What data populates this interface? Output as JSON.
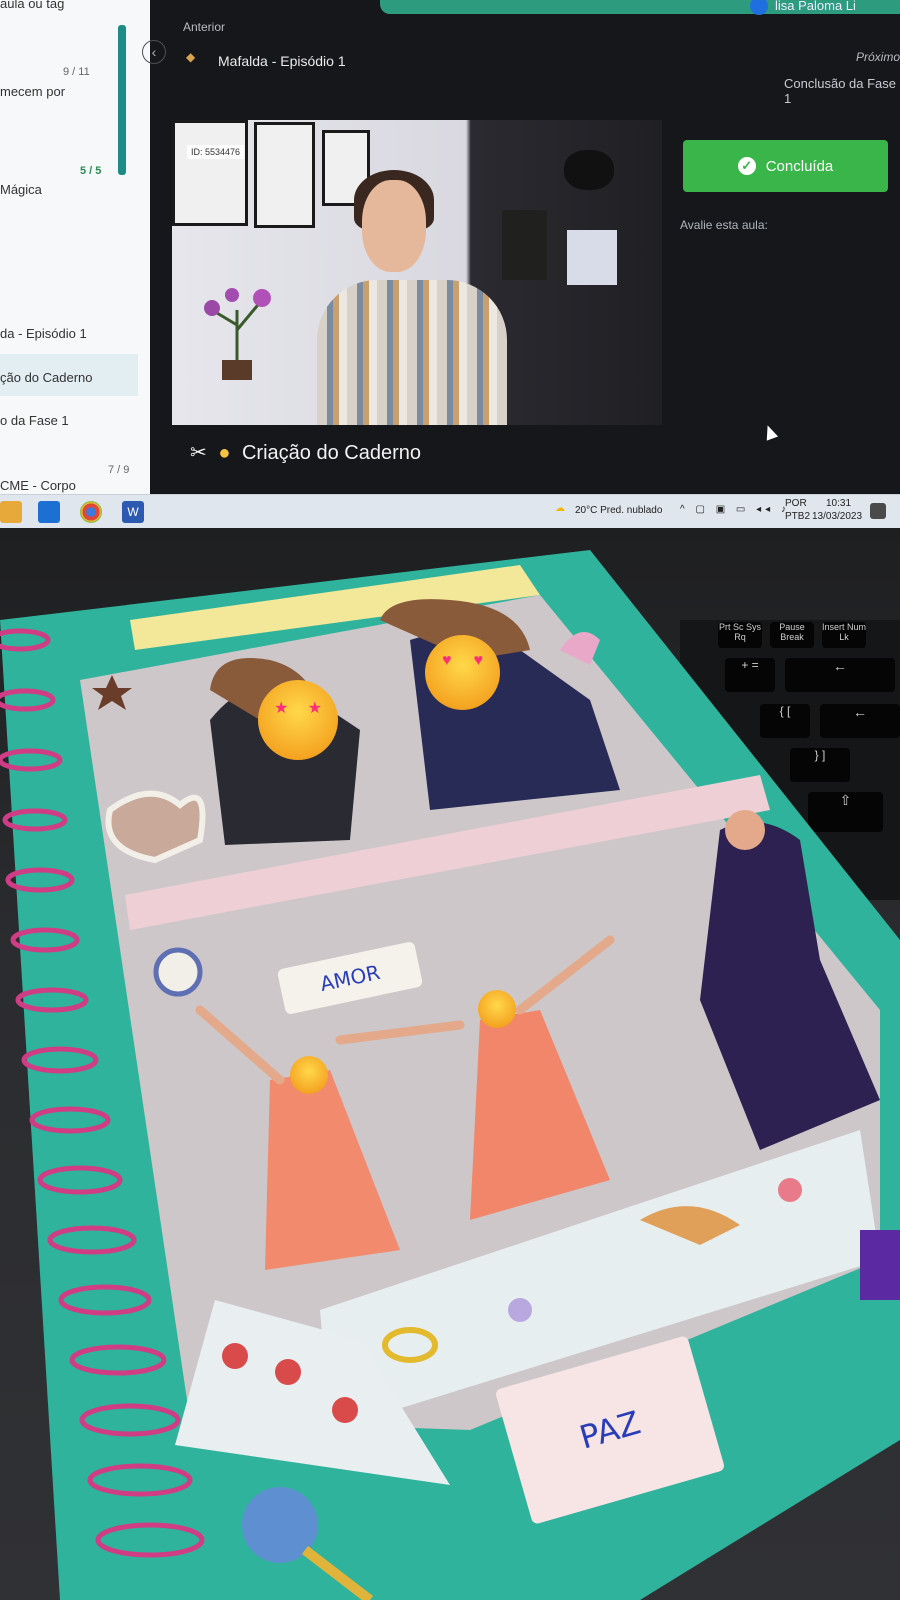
{
  "sidebar": {
    "items": [
      {
        "label": "aula ou tag"
      },
      {
        "label": "mecem por"
      },
      {
        "label": "Mágica"
      },
      {
        "label": "da - Episódio 1"
      },
      {
        "label": "ção do Caderno"
      },
      {
        "label": "o da Fase 1"
      },
      {
        "label": "CME - Corpo"
      }
    ],
    "counts": [
      "9 / 11",
      "5 / 5",
      "7 / 9"
    ]
  },
  "player": {
    "prev_label": "Anterior",
    "prev_title": "Mafalda - Episódio 1",
    "next_label": "Próximo",
    "next_title": "Conclusão da Fase 1",
    "video_id_tag": "ID: 5534476",
    "caption": "Criação do Caderno",
    "done_label": "Concluída",
    "rate_label": "Avalie esta aula:",
    "user_name": "lisa Paloma Li"
  },
  "taskbar": {
    "weather": "20°C Pred. nublado",
    "lang": "POR",
    "layout": "PTB2",
    "time": "10:31",
    "date": "13/03/2023"
  },
  "keyboard": {
    "keys": [
      "Prt Sc Sys Rq",
      "Pause Break",
      "Insert Num Lk",
      "+ =",
      "←",
      "{ [",
      "←",
      "} ]",
      "⇧"
    ]
  },
  "notebook": {
    "labels": {
      "amor": "AMOR",
      "paz": "PAZ"
    }
  },
  "colors": {
    "accent_green": "#39b54a",
    "cover_teal": "#2fb39c",
    "spiral_pink": "#d03c86"
  }
}
